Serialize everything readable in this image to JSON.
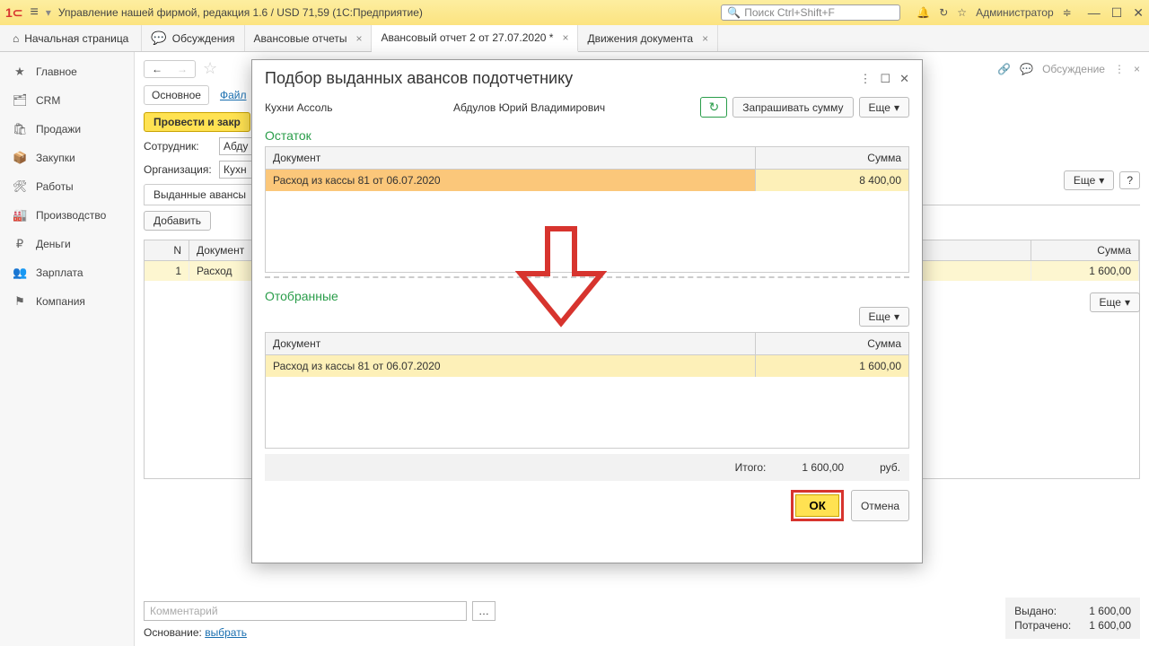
{
  "titlebar": {
    "app_title": "Управление нашей фирмой, редакция 1.6 / USD 71,59  (1С:Предприятие)",
    "search_placeholder": "Поиск Ctrl+Shift+F",
    "admin": "Администратор"
  },
  "tabs": {
    "home": "Начальная страница",
    "items": [
      {
        "label": "Обсуждения",
        "icon": "chat",
        "closable": false
      },
      {
        "label": "Авансовые отчеты",
        "closable": true
      },
      {
        "label": "Авансовый отчет 2 от 27.07.2020 *",
        "closable": true,
        "active": true
      },
      {
        "label": "Движения документа",
        "closable": true
      }
    ]
  },
  "sidebar": [
    {
      "icon": "★",
      "label": "Главное"
    },
    {
      "icon": "🗂",
      "label": "CRM"
    },
    {
      "icon": "🛍",
      "label": "Продажи"
    },
    {
      "icon": "📦",
      "label": "Закупки"
    },
    {
      "icon": "🛠",
      "label": "Работы"
    },
    {
      "icon": "🏭",
      "label": "Производство"
    },
    {
      "icon": "₽",
      "label": "Деньги"
    },
    {
      "icon": "👥",
      "label": "Зарплата"
    },
    {
      "icon": "⚑",
      "label": "Компания"
    }
  ],
  "doc": {
    "links": {
      "main": "Основное",
      "files": "Файл"
    },
    "btn_post": "Провести и закр",
    "more": "Еще",
    "discuss": "Обсуждение",
    "employee_label": "Сотрудник:",
    "employee_val": "Абду",
    "org_label": "Организация:",
    "org_val": "Кухн",
    "subtab": "Выданные авансы",
    "add": "Добавить",
    "col_n": "N",
    "col_doc": "Документ",
    "col_sum": "Сумма",
    "row_n": "1",
    "row_doc": "Расход ",
    "row_sum": "1 600,00",
    "comment_ph": "Комментарий",
    "osnov": "Основание:",
    "osnov_link": "выбрать",
    "issued_label": "Выдано:",
    "issued_val": "1 600,00",
    "spent_label": "Потрачено:",
    "spent_val": "1 600,00"
  },
  "modal": {
    "title": "Подбор выданных авансов подотчетнику",
    "org": "Кухни Ассоль",
    "person": "Абдулов Юрий Владимирович",
    "request_sum": "Запрашивать сумму",
    "more": "Еще",
    "section_balance": "Остаток",
    "section_selected": "Отобранные",
    "col_doc": "Документ",
    "col_sum": "Сумма",
    "balance_rows": [
      {
        "doc": "Расход из кассы 81 от 06.07.2020",
        "sum": "8 400,00"
      }
    ],
    "selected_rows": [
      {
        "doc": "Расход из кассы 81 от 06.07.2020",
        "sum": "1 600,00"
      }
    ],
    "total_label": "Итого:",
    "total_val": "1 600,00",
    "total_cur": "руб.",
    "ok": "ОК",
    "cancel": "Отмена"
  }
}
